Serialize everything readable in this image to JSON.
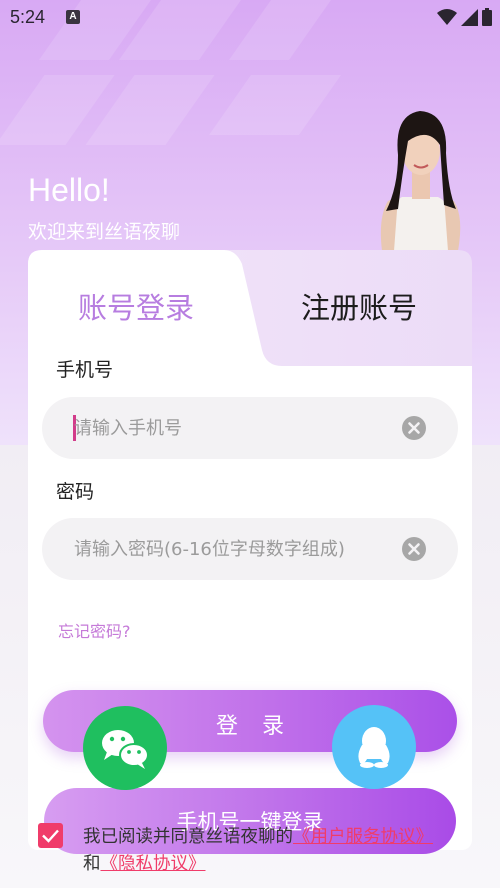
{
  "status_bar": {
    "time": "5:24",
    "notification_icon": "A"
  },
  "header": {
    "greeting": "Hello!",
    "welcome": "欢迎来到丝语夜聊"
  },
  "tabs": {
    "login": "账号登录",
    "register": "注册账号"
  },
  "form": {
    "phone_label": "手机号",
    "phone_placeholder": "请输入手机号",
    "phone_value": "",
    "password_label": "密码",
    "password_placeholder": "请输入密码(6-16位字母数字组成)",
    "password_value": "",
    "forgot_password": "忘记密码?"
  },
  "buttons": {
    "login": "登录",
    "one_click_login": "手机号一键登录"
  },
  "social": {
    "wechat_icon": "wechat-icon",
    "qq_icon": "qq-icon"
  },
  "agreement": {
    "checked": true,
    "prefix": "我已阅读并同意丝语夜聊的",
    "service_link": "《用户服务协议》",
    "and": "和",
    "privacy_link": "《隐私协议》"
  },
  "colors": {
    "accent_purple": "#b77de0",
    "button_gradient_start": "#d493ee",
    "button_gradient_end": "#aa50e8",
    "link_pink": "#f03c6a",
    "wechat_green": "#1fbf5f",
    "qq_blue": "#55c2f7"
  }
}
